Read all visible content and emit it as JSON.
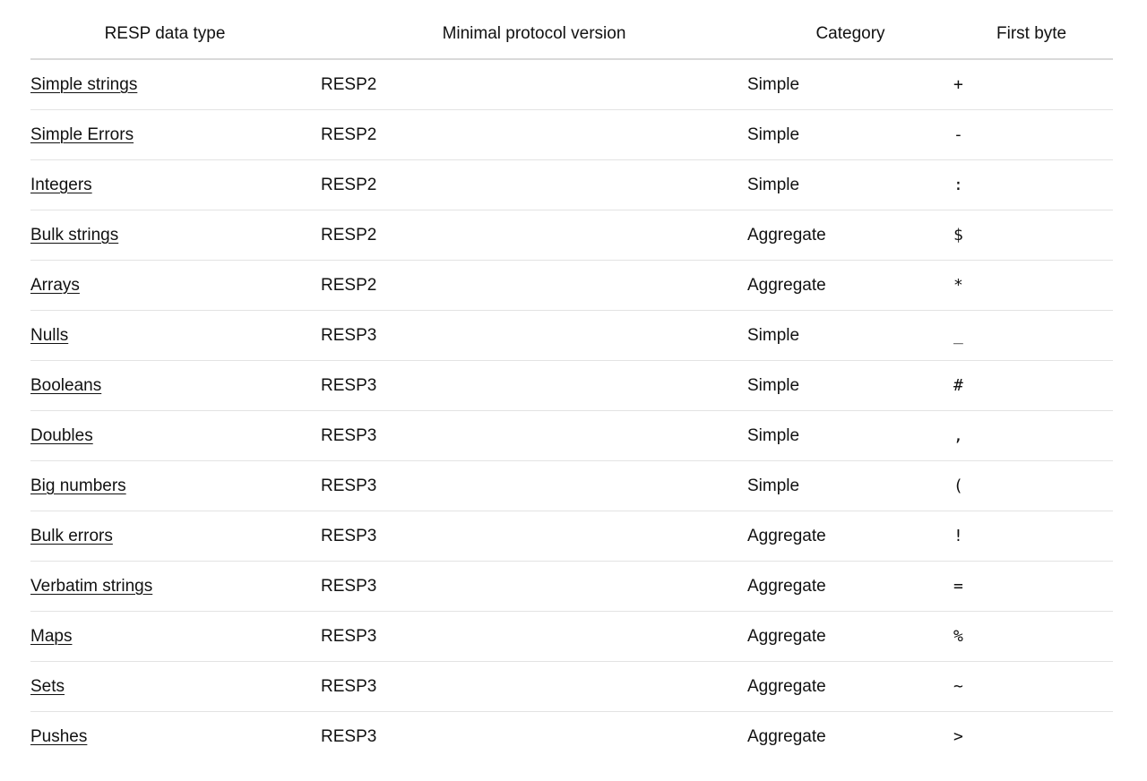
{
  "table": {
    "headers": [
      "RESP data type",
      "Minimal protocol version",
      "Category",
      "First byte"
    ],
    "rows": [
      {
        "type": "Simple strings",
        "version": "RESP2",
        "category": "Simple",
        "first_byte": "+"
      },
      {
        "type": "Simple Errors",
        "version": "RESP2",
        "category": "Simple",
        "first_byte": "-"
      },
      {
        "type": "Integers",
        "version": "RESP2",
        "category": "Simple",
        "first_byte": ":"
      },
      {
        "type": "Bulk strings",
        "version": "RESP2",
        "category": "Aggregate",
        "first_byte": "$"
      },
      {
        "type": "Arrays",
        "version": "RESP2",
        "category": "Aggregate",
        "first_byte": "*"
      },
      {
        "type": "Nulls",
        "version": "RESP3",
        "category": "Simple",
        "first_byte": "_"
      },
      {
        "type": "Booleans",
        "version": "RESP3",
        "category": "Simple",
        "first_byte": "#"
      },
      {
        "type": "Doubles",
        "version": "RESP3",
        "category": "Simple",
        "first_byte": ","
      },
      {
        "type": "Big numbers",
        "version": "RESP3",
        "category": "Simple",
        "first_byte": "("
      },
      {
        "type": "Bulk errors",
        "version": "RESP3",
        "category": "Aggregate",
        "first_byte": "!"
      },
      {
        "type": "Verbatim strings",
        "version": "RESP3",
        "category": "Aggregate",
        "first_byte": "="
      },
      {
        "type": "Maps",
        "version": "RESP3",
        "category": "Aggregate",
        "first_byte": "%"
      },
      {
        "type": "Sets",
        "version": "RESP3",
        "category": "Aggregate",
        "first_byte": "~"
      },
      {
        "type": "Pushes",
        "version": "RESP3",
        "category": "Aggregate",
        "first_byte": ">"
      }
    ]
  }
}
